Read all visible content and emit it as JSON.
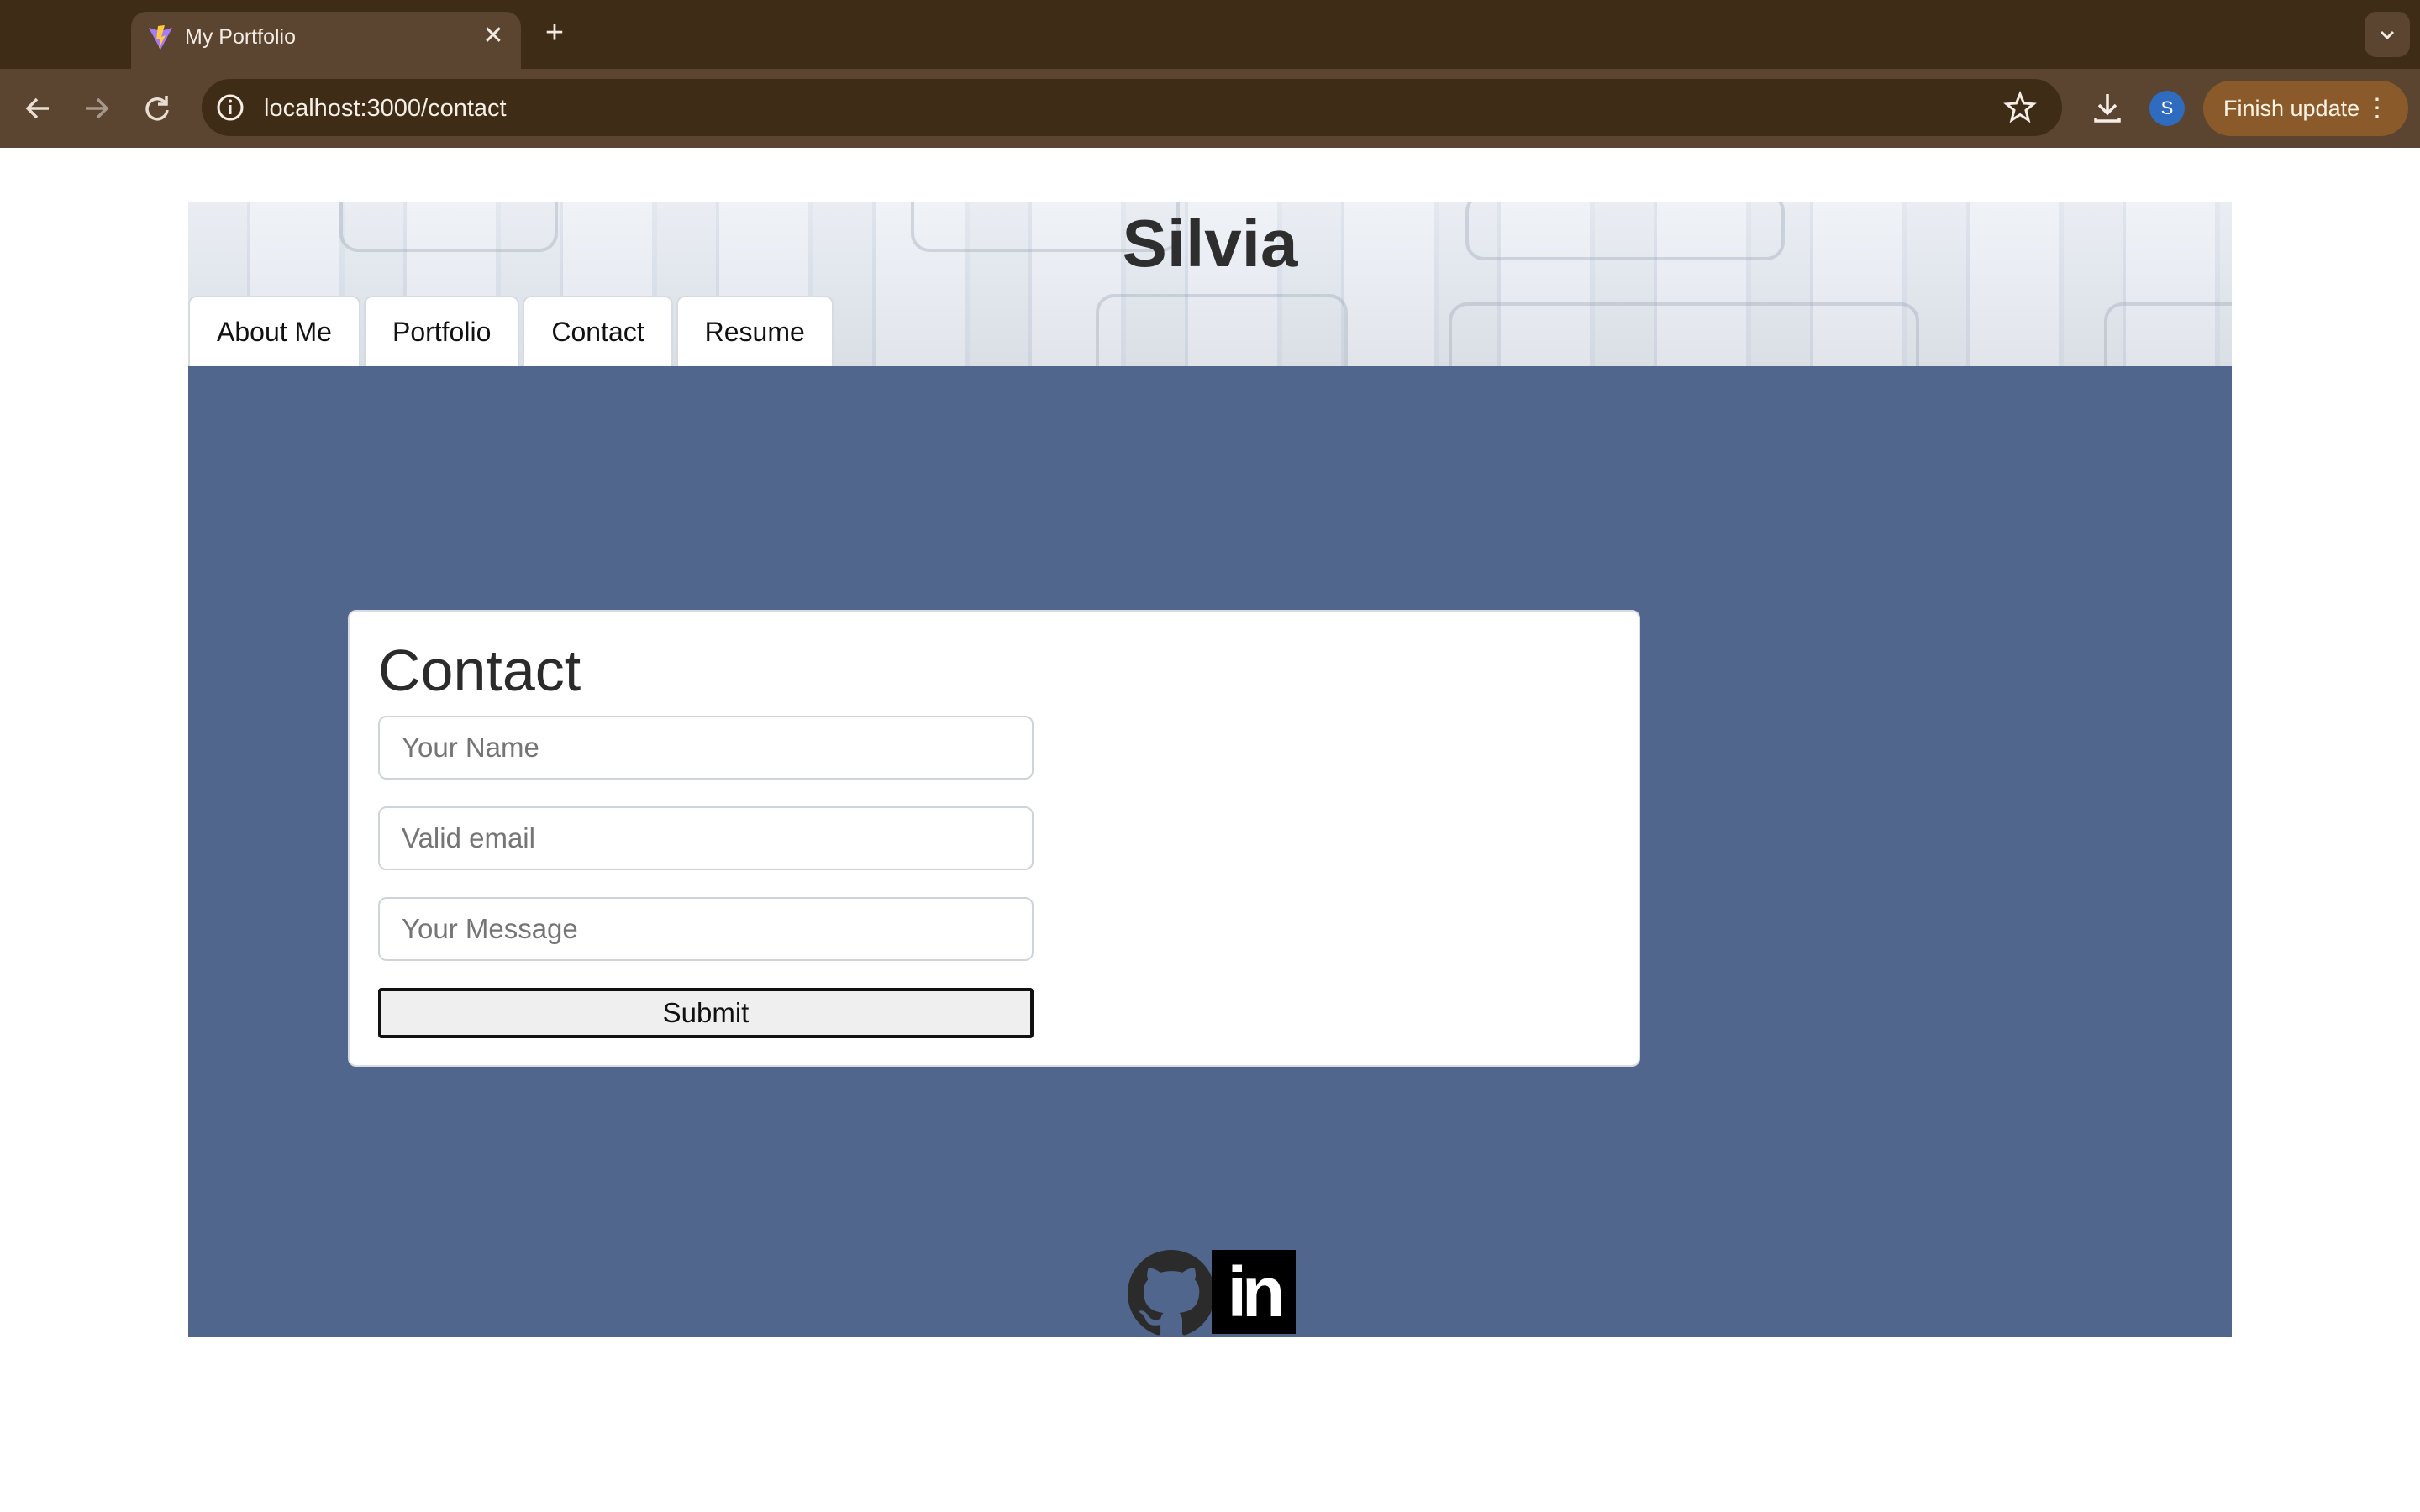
{
  "browser": {
    "tab_title": "My Portfolio",
    "tab_close": "✕",
    "new_tab": "+",
    "url": "localhost:3000/contact",
    "profile_initial": "S",
    "finish_update": "Finish update"
  },
  "site": {
    "title": "Silvia",
    "nav": [
      "About Me",
      "Portfolio",
      "Contact",
      "Resume"
    ]
  },
  "contact": {
    "heading": "Contact",
    "name_placeholder": "Your Name",
    "email_placeholder": "Valid email",
    "message_placeholder": "Your Message",
    "submit_label": "Submit"
  },
  "footer": {
    "linkedin_text": "in"
  },
  "colors": {
    "chrome_dark": "#3f2c16",
    "chrome_toolbar": "#5b4430",
    "main_background": "#51668c",
    "finish_update": "#8a5a2b"
  },
  "icons": [
    "vite-favicon-icon",
    "close-icon",
    "plus-icon",
    "back-icon",
    "forward-icon",
    "reload-icon",
    "info-icon",
    "star-icon",
    "download-icon",
    "more-vert-icon",
    "chevron-down-icon",
    "github-icon",
    "linkedin-icon"
  ]
}
